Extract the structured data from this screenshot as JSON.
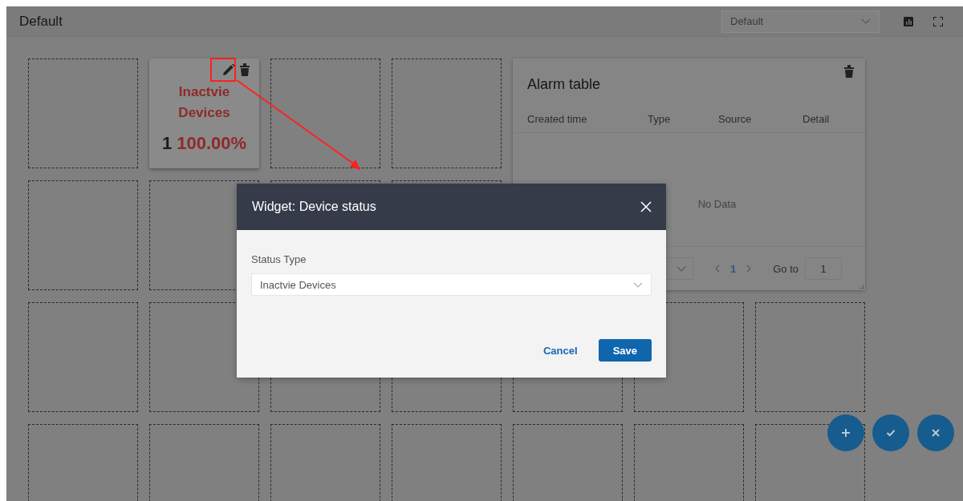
{
  "header": {
    "title": "Default",
    "dashboard_select": {
      "value": "Default"
    }
  },
  "device_widget": {
    "title": "Inactvie Devices",
    "count": "1",
    "percent": "100.00%"
  },
  "alarm_table": {
    "title": "Alarm table",
    "columns": [
      "Created time",
      "Type",
      "Source",
      "Detail"
    ],
    "empty_text": "No Data",
    "pagination": {
      "pages": [
        {
          "label": "1",
          "selected": true
        }
      ],
      "goto_label": "Go to",
      "goto_value": "1"
    }
  },
  "modal": {
    "title": "Widget: Device status",
    "field_label": "Status Type",
    "field_value": "Inactvie Devices",
    "buttons": [
      {
        "kind": "text",
        "label": "Cancel"
      },
      {
        "kind": "primary",
        "label": "Save"
      }
    ]
  },
  "fab_buttons": [
    {
      "kind": "add"
    },
    {
      "kind": "confirm"
    },
    {
      "kind": "cancel"
    }
  ]
}
